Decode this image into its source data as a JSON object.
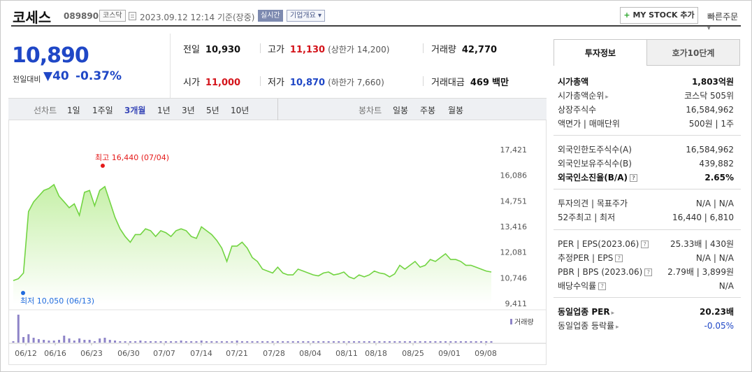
{
  "header": {
    "stock_name": "코세스",
    "stock_code": "089890",
    "market_badge": "코스닥",
    "timestamp": "2023.09.12 12:14 기준(장중)",
    "realtime_badge": "실시간",
    "company_overview": "기업개요 ▾",
    "mystock_plus": "+",
    "mystock_label": "MY STOCK 추가",
    "quick_order": "빠른주문"
  },
  "price": {
    "current": "10,890",
    "change_label": "전일대비",
    "change_arrow": "▼",
    "change_value": "40",
    "change_pct": "-0.37%"
  },
  "stats": {
    "prev_label": "전일",
    "prev_value": "10,930",
    "high_label": "고가",
    "high_value": "11,130",
    "upper_limit": "(상한가 14,200)",
    "volume_label": "거래량",
    "volume_value": "42,770",
    "open_label": "시가",
    "open_value": "11,000",
    "low_label": "저가",
    "low_value": "10,870",
    "lower_limit": "(하한가 7,660)",
    "amount_label": "거래대금",
    "amount_value": "469",
    "amount_unit": "백만"
  },
  "periods": {
    "line_label": "선차트",
    "items": [
      "1일",
      "1주일",
      "3개월",
      "1년",
      "3년",
      "5년",
      "10년"
    ],
    "selected": "3개월",
    "candle_label": "봉차트",
    "candle_items": [
      "일봉",
      "주봉",
      "월봉"
    ]
  },
  "chart_data": {
    "type": "area",
    "y_ticks": [
      "17,421",
      "16,086",
      "14,751",
      "13,416",
      "12,081",
      "10,746",
      "9,411"
    ],
    "ylim": [
      9411,
      17421
    ],
    "x_ticks": [
      "06/12",
      "06/16",
      "06/23",
      "06/30",
      "07/07",
      "07/14",
      "07/21",
      "07/28",
      "08/04",
      "08/11",
      "08/18",
      "08/25",
      "09/01",
      "09/08"
    ],
    "high_annotation": "최고 16,440 (07/04)",
    "low_annotation": "최저 10,050 (06/13)",
    "volume_legend": "거래량",
    "price_series": [
      10600,
      10700,
      11000,
      14200,
      14700,
      15000,
      15300,
      15400,
      15600,
      15000,
      14700,
      14400,
      14600,
      14000,
      15200,
      15300,
      14500,
      15300,
      15500,
      14700,
      13900,
      13300,
      12900,
      12600,
      13000,
      13000,
      13300,
      13200,
      12900,
      13200,
      13100,
      12900,
      13200,
      13300,
      13200,
      12900,
      12800,
      13400,
      13200,
      13000,
      12700,
      12300,
      11600,
      12400,
      12400,
      12600,
      12300,
      11800,
      11600,
      11200,
      11100,
      11000,
      11300,
      11000,
      10900,
      10900,
      11200,
      11100,
      11000,
      10900,
      10850,
      11000,
      11050,
      10900,
      10950,
      11050,
      10800,
      10700,
      10900,
      10800,
      10900,
      11100,
      11000,
      10950,
      10800,
      10950,
      11400,
      11200,
      11400,
      11600,
      11300,
      11400,
      11700,
      11600,
      11800,
      12000,
      11700,
      11700,
      11600,
      11400,
      11400,
      11300,
      11200,
      11100,
      11050
    ],
    "volume_series": [
      2,
      40,
      8,
      12,
      7,
      5,
      4,
      3,
      3,
      4,
      10,
      6,
      3,
      6,
      4,
      4,
      2,
      6,
      7,
      4,
      3,
      2,
      2,
      2,
      2,
      3,
      2,
      2,
      2,
      2,
      2,
      2,
      2,
      3,
      2,
      2,
      2,
      3,
      2,
      2,
      2,
      2,
      2,
      2,
      3,
      2,
      2,
      2,
      2,
      2,
      2,
      2,
      2,
      2,
      2,
      2,
      2,
      2,
      2,
      2,
      2,
      2,
      2,
      2,
      2,
      2,
      2,
      2,
      2,
      2,
      2,
      2,
      2,
      2,
      2,
      2,
      2,
      2,
      2,
      2,
      2,
      2,
      2,
      2,
      2,
      2,
      2,
      2,
      2,
      2,
      2,
      2,
      2,
      2,
      2
    ],
    "high_index": 18,
    "low_index": 0,
    "colors": {
      "line": "#72d442",
      "fill_top": "#c6f0a8",
      "fill_bottom": "#ffffff",
      "volume": "#8e84c8",
      "high_dot": "#e51a1a",
      "low_dot": "#1f6bde"
    }
  },
  "right_panel": {
    "tabs": [
      "투자정보",
      "호가10단계"
    ],
    "rows": [
      {
        "k": "시가총액",
        "v": "1,803억원",
        "bold": true
      },
      {
        "k": "시가총액순위",
        "v": "코스닥 505위",
        "caret": true
      },
      {
        "k": "상장주식수",
        "v": "16,584,962"
      },
      {
        "k": "액면가 | 매매단위",
        "v": "500원 | 1주"
      },
      {
        "k": "외국인한도주식수(A)",
        "v": "16,584,962"
      },
      {
        "k": "외국인보유주식수(B)",
        "v": "439,882"
      },
      {
        "k": "외국인소진율(B/A)",
        "v": "2.65%",
        "bold": true,
        "help": true
      },
      {
        "k": "투자의견 | 목표주가",
        "v": "N/A | N/A"
      },
      {
        "k": "52주최고 | 최저",
        "v": "16,440 | 6,810"
      },
      {
        "k": "PER | EPS(2023.06)",
        "v": "25.33배 | 430원",
        "help": true
      },
      {
        "k": "추정PER | EPS",
        "v": "N/A | N/A",
        "help": true
      },
      {
        "k": "PBR | BPS (2023.06)",
        "v": "2.79배 | 3,899원",
        "help": true
      },
      {
        "k": "배당수익률",
        "v": "N/A",
        "help": true
      },
      {
        "k": "동일업종 PER",
        "v": "20.23배",
        "bold": true,
        "caret": true
      },
      {
        "k": "동일업종 등락률",
        "v": "-0.05%",
        "caret": true,
        "blue": true
      }
    ]
  }
}
